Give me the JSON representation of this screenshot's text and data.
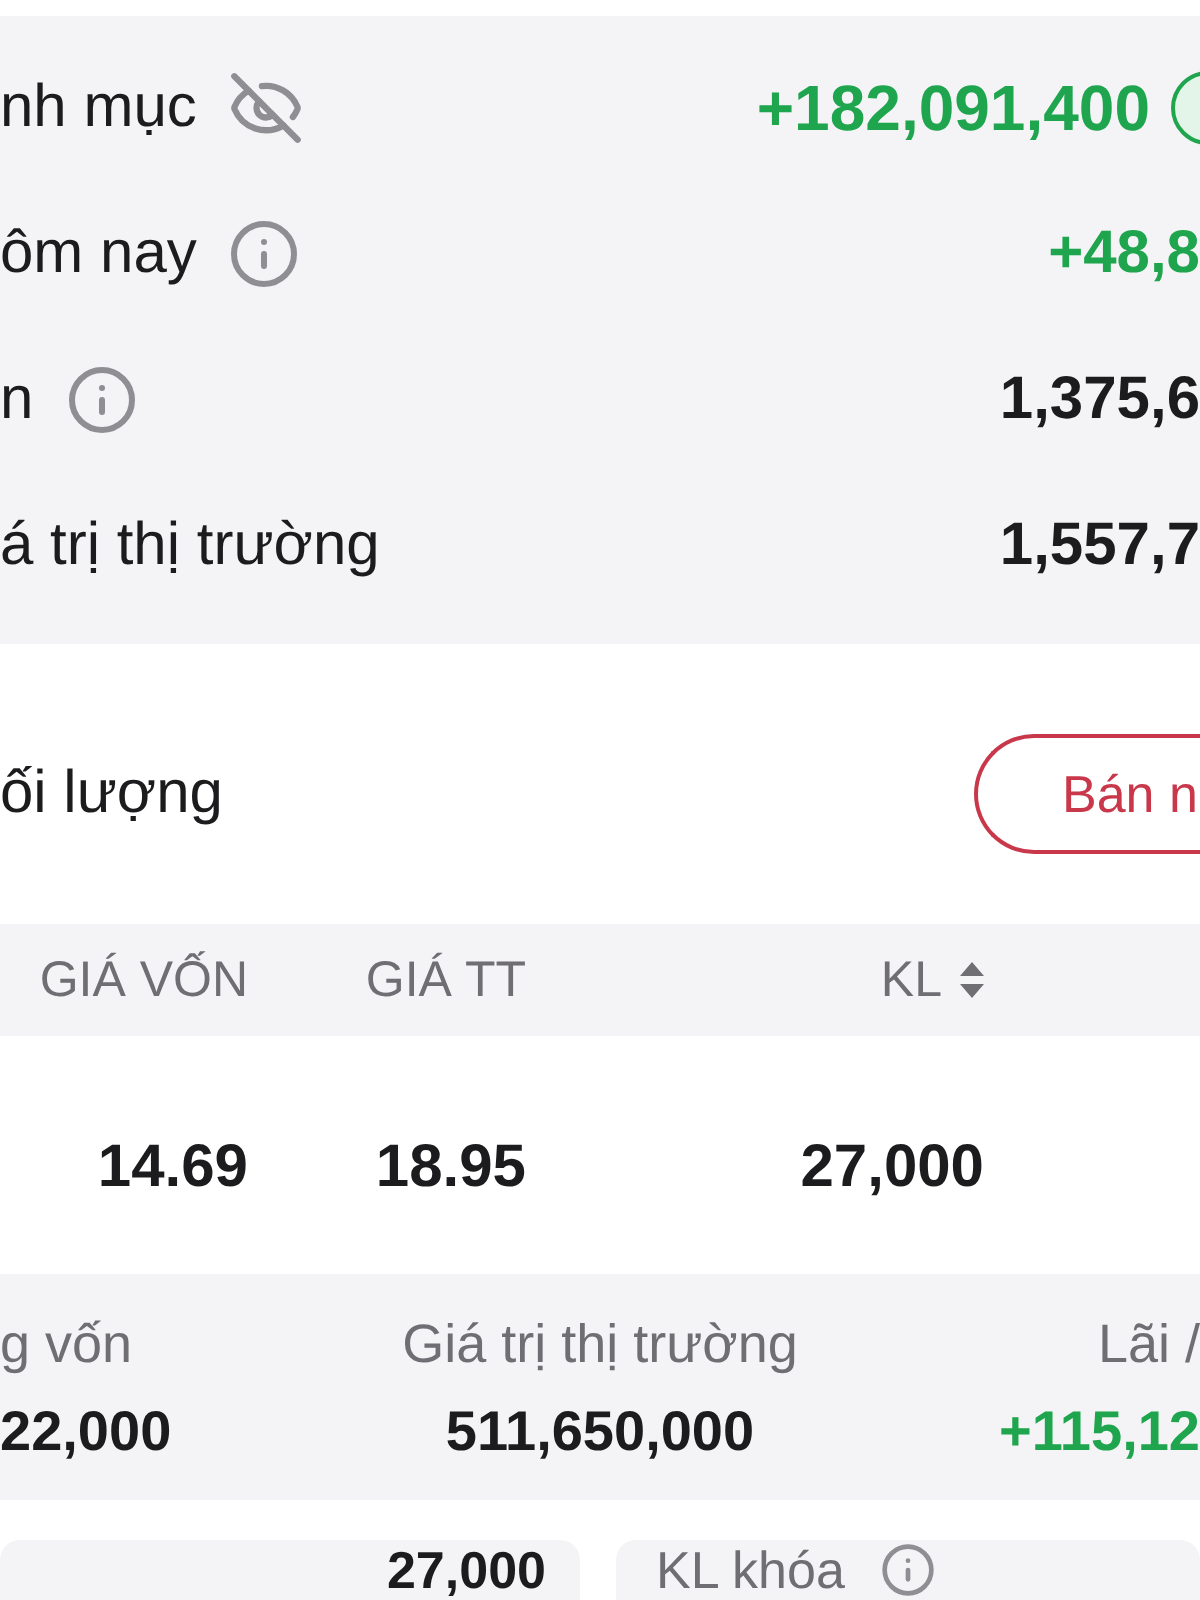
{
  "overview": {
    "rows": [
      {
        "kind": "total",
        "label": "nh mục",
        "value": "+182,091,400",
        "color": "#1fa54d"
      },
      {
        "kind": "info",
        "label": "ôm nay",
        "value": "+48,8",
        "color": "#1fa54d"
      },
      {
        "kind": "info",
        "label": "n",
        "value": "1,375,6",
        "color": "#1c1c1e"
      },
      {
        "kind": "plain",
        "label": "á trị thị trường",
        "value": "1,557,7",
        "color": "#1c1c1e"
      }
    ]
  },
  "holdings": {
    "title": "ối lượng",
    "action": "Bán n"
  },
  "table": {
    "columns": [
      {
        "kind": "plain",
        "label": "GIÁ VỐN"
      },
      {
        "kind": "plain",
        "label": "GIÁ TT"
      },
      {
        "kind": "sort",
        "label": "KL"
      }
    ],
    "rows": [
      [
        "14.69",
        "18.95",
        "27,000"
      ]
    ]
  },
  "summary": {
    "items": [
      {
        "label": "g vốn",
        "value": "22,000",
        "color": "#1c1c1e"
      },
      {
        "label": "Giá trị thị trường",
        "value": "511,650,000",
        "color": "#1c1c1e"
      },
      {
        "label": "Lãi /",
        "value": "+115,12",
        "color": "#1fa54d"
      }
    ]
  },
  "cards": [
    {
      "kind": "value",
      "value": "27,000"
    },
    {
      "kind": "info-label",
      "label": "KL khóa"
    }
  ]
}
